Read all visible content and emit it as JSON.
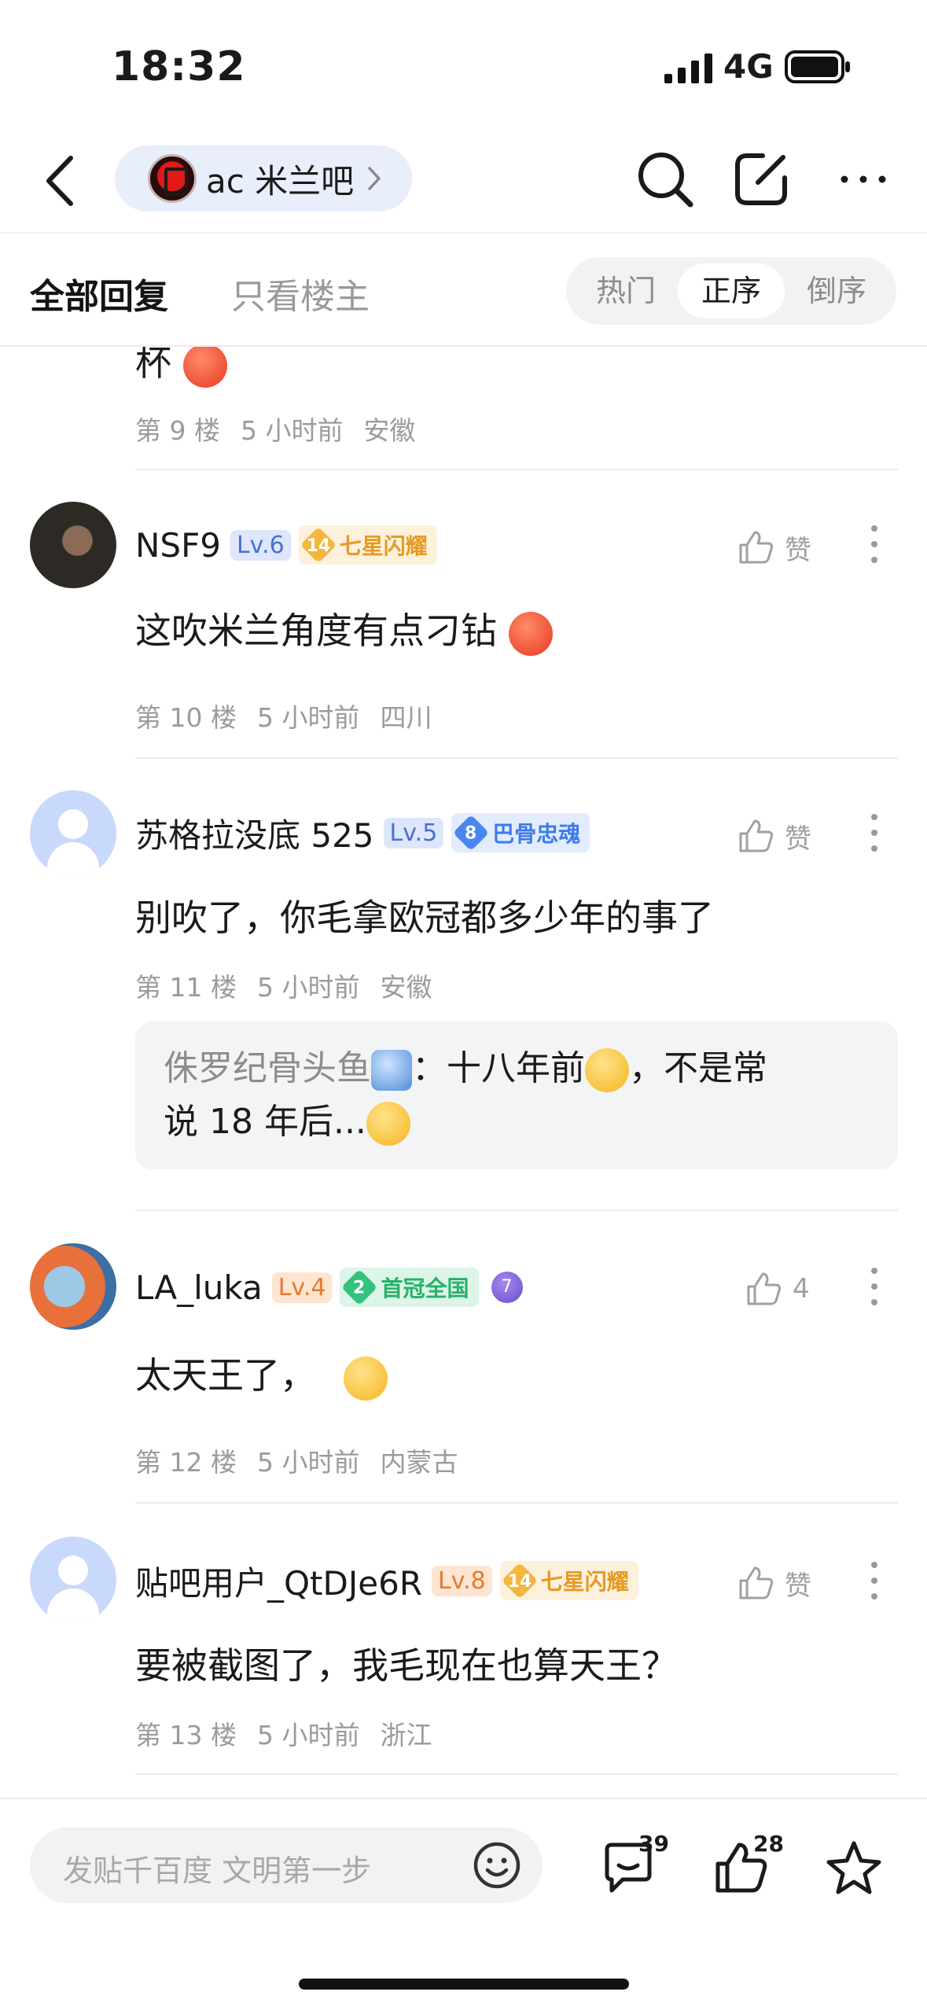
{
  "status": {
    "time": "18:32",
    "network": "4G"
  },
  "nav": {
    "forum_name": "ac 米兰吧"
  },
  "tabs": {
    "all": "全部回复",
    "owner": "只看楼主",
    "sort": [
      "热门",
      "正序",
      "倒序"
    ]
  },
  "prev_post": {
    "content_tail": "杯",
    "floor": "第 9 楼",
    "time": "5 小时前",
    "location": "安徽"
  },
  "posts": [
    {
      "username": "NSF9",
      "level": "Lv.6",
      "badge_num": "14",
      "badge_text": "七星闪耀",
      "like": "赞",
      "content": "这吹米兰角度有点刁钻",
      "floor": "第 10 楼",
      "time": "5 小时前",
      "location": "四川"
    },
    {
      "username": "苏格拉没底 525",
      "level": "Lv.5",
      "badge_num": "8",
      "badge_text": "巴骨忠魂",
      "like": "赞",
      "content": "别吹了，你毛拿欧冠都多少年的事了",
      "floor": "第 11 楼",
      "time": "5 小时前",
      "location": "安徽",
      "subreply": {
        "name": "侏罗纪骨头鱼",
        "text_a": "：十八年前",
        "text_b": "，不是常",
        "text_c": "说 18 年后..."
      }
    },
    {
      "username": "LA_luka",
      "level": "Lv.4",
      "badge_num": "2",
      "badge_text": "首冠全国",
      "extra_badge": "7",
      "like": "4",
      "content": "太天王了，",
      "floor": "第 12 楼",
      "time": "5 小时前",
      "location": "内蒙古"
    },
    {
      "username": "贴吧用户_QtDJe6R",
      "level": "Lv.8",
      "badge_num": "14",
      "badge_text": "七星闪耀",
      "like": "赞",
      "content": "要被截图了，我毛现在也算天王？",
      "floor": "第 13 楼",
      "time": "5 小时前",
      "location": "浙江"
    }
  ],
  "bottom": {
    "placeholder": "发贴千百度 文明第一步",
    "comment_count": "39",
    "like_count": "28"
  },
  "colors": {
    "accent_blue": "#4a6fd0",
    "badge_gold": "#f3b63f",
    "badge_green": "#35c27f"
  }
}
